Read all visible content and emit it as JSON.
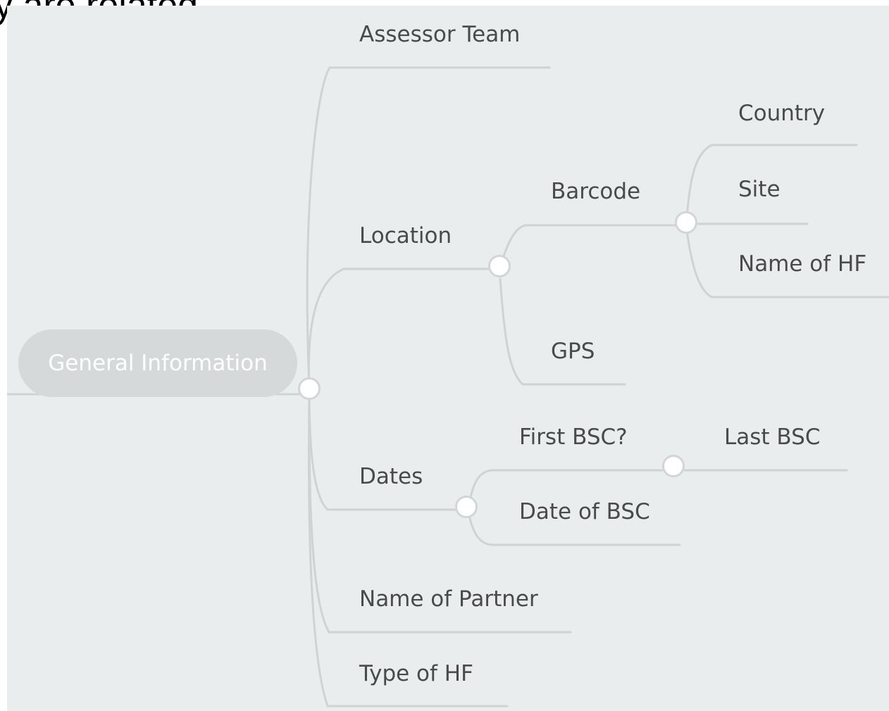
{
  "header_text": "y are related",
  "mindmap": {
    "root": "General Information",
    "branches": {
      "assessor_team": "Assessor Team",
      "location": "Location",
      "barcode": "Barcode",
      "country": "Country",
      "site": "Site",
      "name_of_hf": "Name of HF",
      "gps": "GPS",
      "dates": "Dates",
      "first_bsc": "First BSC?",
      "last_bsc": "Last BSC",
      "date_of_bsc": "Date of BSC",
      "name_of_partner": "Name of Partner",
      "type_of_hf": "Type of HF"
    }
  },
  "colors": {
    "background": "#e9edee",
    "connector": "#cfd3d4",
    "label": "#4a4a4a",
    "root_fill": "#d5d9da",
    "root_text": "#ffffff"
  }
}
